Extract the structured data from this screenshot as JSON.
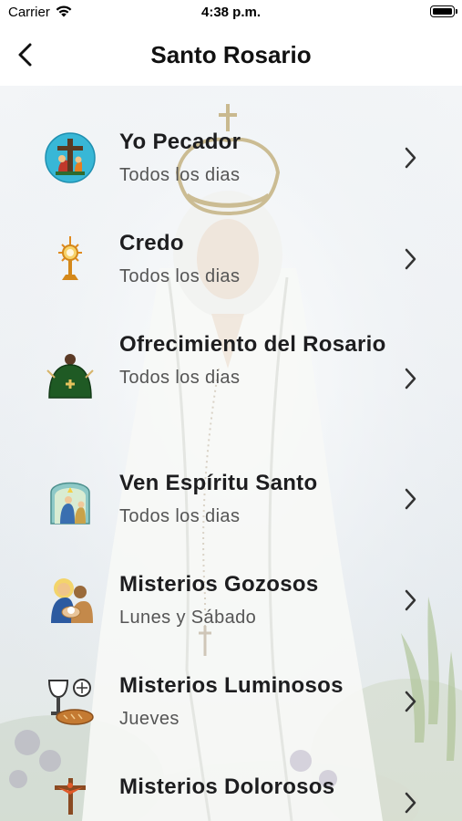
{
  "status_bar": {
    "carrier": "Carrier",
    "time": "4:38 p.m.",
    "icons": [
      "wifi-icon",
      "battery-icon"
    ]
  },
  "navbar": {
    "title": "Santo Rosario",
    "back_icon": "chevron-left-icon"
  },
  "items": [
    {
      "name": "Yo Pecador",
      "schedule": "Todos los dias",
      "icon": "penitent-cross-icon"
    },
    {
      "name": "Credo",
      "schedule": "Todos los dias",
      "icon": "monstrance-icon"
    },
    {
      "name": "Ofrecimiento del Rosario",
      "schedule": "Todos los dias",
      "icon": "chasuble-icon"
    },
    {
      "name": "Ven Espíritu Santo",
      "schedule": "Todos los dias",
      "icon": "pentecost-icon"
    },
    {
      "name": "Misterios Gozosos",
      "schedule": "Lunes y Sábado",
      "icon": "holy-family-icon"
    },
    {
      "name": "Misterios Luminosos",
      "schedule": "Jueves",
      "icon": "chalice-bread-icon"
    },
    {
      "name": "Misterios Dolorosos",
      "schedule": "",
      "icon": "crucifix-icon"
    }
  ],
  "colors": {
    "title": "#111111",
    "item_name": "#1d1d1f",
    "item_subtitle": "#555555",
    "chevron": "#333333"
  }
}
